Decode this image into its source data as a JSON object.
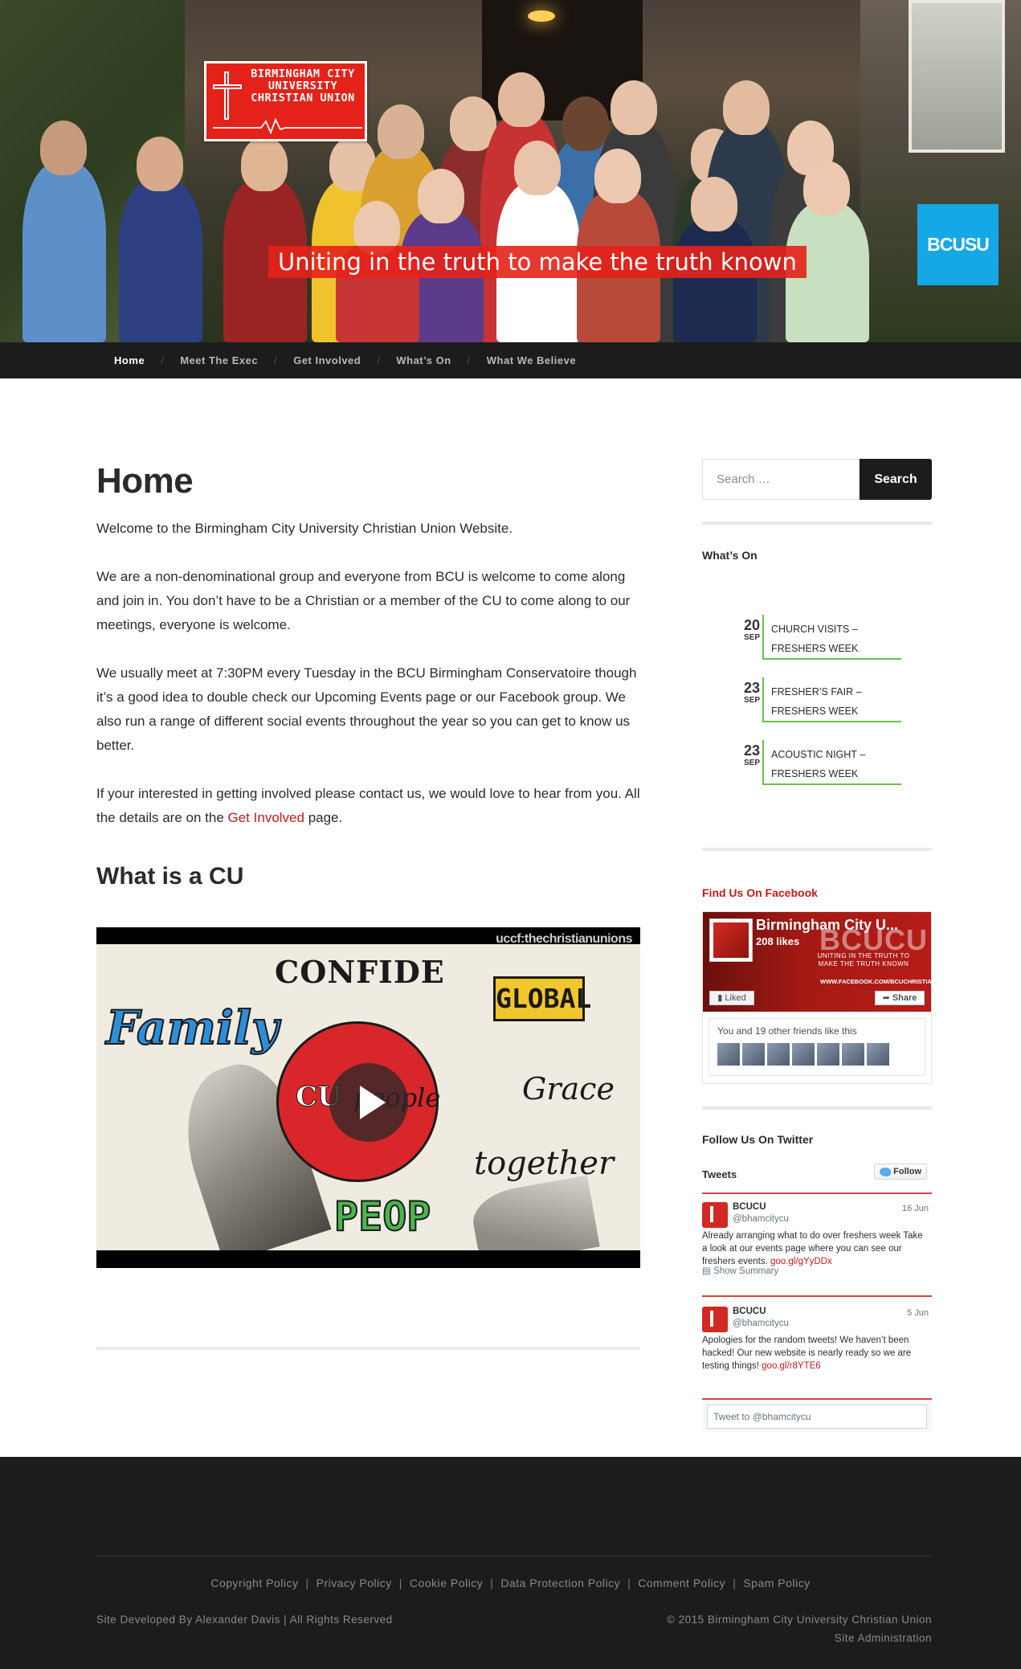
{
  "header": {
    "logo_text_line1": "BIRMINGHAM CITY",
    "logo_text_line2": "UNIVERSITY",
    "logo_text_line3": "CHRISTIAN UNION",
    "tagline": "Uniting in the truth to make the truth known",
    "union_badge": "BCUSU",
    "brand_red": "#e42219",
    "badge_blue": "#15a8e6"
  },
  "nav": {
    "items": [
      {
        "label": "Home",
        "active": true
      },
      {
        "label": "Meet The Exec",
        "active": false
      },
      {
        "label": "Get Involved",
        "active": false
      },
      {
        "label": "What’s On",
        "active": false
      },
      {
        "label": "What We Believe",
        "active": false
      }
    ],
    "separator": "/"
  },
  "main": {
    "title": "Home",
    "paragraphs": [
      "Welcome to the Birmingham City University Christian Union Website.",
      "We are a non-denominational group and everyone from BCU is welcome to come along and join in. You don’t have to be a Christian or a member of the CU to come along to our meetings, everyone is welcome.",
      "We usually meet at 7:30PM every Tuesday in the BCU Birmingham Conservatoire though it’s a good idea to double check our Upcoming Events page or our Facebook group. We also run a range of different social events throughout the year so you can get to know us better."
    ],
    "contact_text_before": "If your interested in getting involved please contact us, we would love to hear from you. All the details are on the ",
    "contact_link": "Get Involved",
    "contact_text_after": " page.",
    "subtitle": "What is a CU",
    "video": {
      "watermark": "uccf:thechristianunions",
      "words": {
        "confide": "CONFIDE",
        "global": "GLOBAL",
        "family": "Family",
        "cu": "CU",
        "people": "people",
        "grace": "Grace",
        "together": "together",
        "peop": "PEOP"
      }
    },
    "link_color": "#c51b1b"
  },
  "sidebar": {
    "search": {
      "placeholder": "Search …",
      "button": "Search"
    },
    "whats_on": {
      "title": "What’s On",
      "events": [
        {
          "day": "20",
          "month": "SEP",
          "title_line1": "Church Visits –",
          "title_line2": "Freshers Week"
        },
        {
          "day": "23",
          "month": "SEP",
          "title_line1": "Fresher’s Fair –",
          "title_line2": "Freshers Week"
        },
        {
          "day": "23",
          "month": "SEP",
          "title_line1": "Acoustic Night –",
          "title_line2": "Freshers Week"
        }
      ],
      "accent": "#66c24a"
    },
    "facebook": {
      "title": "Find Us On Facebook",
      "page_name": "Birmingham City U...",
      "likes": "208 likes",
      "cover_big": "BCUCU",
      "cover_small": "UNITING IN THE TRUTH TO MAKE THE TRUTH KNOWN",
      "cover_url": "WWW.FACEBOOK.COM/BCUCHRISTIANUNION",
      "liked_label": "Liked",
      "share_label": "Share",
      "friends_text": "You and 19 other friends like this"
    },
    "twitter": {
      "title": "Follow Us On Twitter",
      "tweets_label": "Tweets",
      "follow_label": "Follow",
      "tweets": [
        {
          "name": "BCUCU",
          "handle": "@bhamcitycu",
          "date": "16 Jun",
          "text": "Already arranging what to do over freshers week Take a look at our events page where you can see our freshers events. ",
          "link": "goo.gl/gYyDDx",
          "summary": "Show Summary"
        },
        {
          "name": "BCUCU",
          "handle": "@bhamcitycu",
          "date": "5 Jun",
          "text": "Apologies for the random tweets! We haven’t been hacked! Our new website is nearly ready so we are testing things! ",
          "link": "goo.gl/r8YTE6"
        }
      ],
      "tweet_to": "Tweet to @bhamcitycu"
    }
  },
  "footer": {
    "links": [
      "Copyright Policy",
      "Privacy Policy",
      "Cookie Policy",
      "Data Protection Policy",
      "Comment Policy",
      "Spam Policy"
    ],
    "separator": "|",
    "developer": "Site Developed By Alexander Davis  |  All Rights Reserved",
    "copyright": "© 2015 Birmingham City University Christian Union",
    "admin": "Site Administration"
  }
}
